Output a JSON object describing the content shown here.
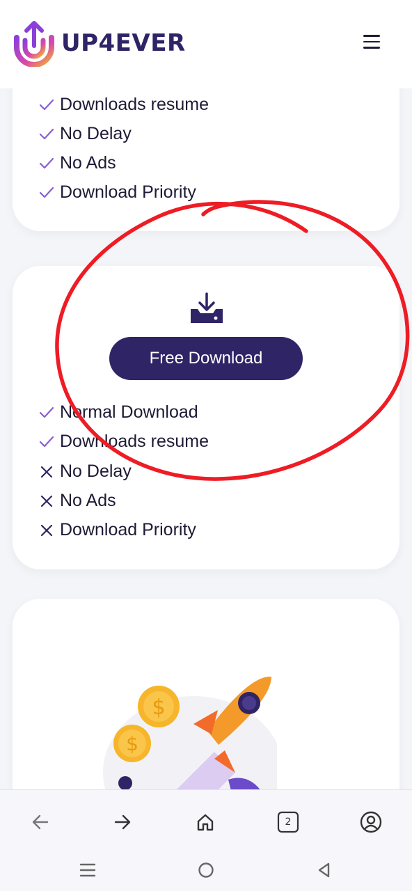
{
  "header": {
    "brand": "UP4EVER",
    "menu_icon": "hamburger-menu-icon"
  },
  "plan_card_top": {
    "features": [
      {
        "label": "Downloads resume",
        "included": true
      },
      {
        "label": "No Delay",
        "included": true
      },
      {
        "label": "No Ads",
        "included": true
      },
      {
        "label": "Download Priority",
        "included": true
      }
    ]
  },
  "free_card": {
    "icon": "download-tray-icon",
    "button_label": "Free Download",
    "features": [
      {
        "label": "Normal Download",
        "included": true
      },
      {
        "label": "Downloads resume",
        "included": true
      },
      {
        "label": "No Delay",
        "included": false
      },
      {
        "label": "No Ads",
        "included": false
      },
      {
        "label": "Download Priority",
        "included": false
      }
    ]
  },
  "browser_nav": {
    "tab_count": "2",
    "buttons": [
      "back-arrow-icon",
      "forward-arrow-icon",
      "home-icon",
      "tabs-icon",
      "account-icon"
    ]
  },
  "system_nav": [
    "recent-apps-icon",
    "home-circle-icon",
    "back-triangle-icon"
  ],
  "colors": {
    "brand": "#2f2466",
    "check": "#8a5cd6",
    "annotation": "#ee1c24"
  }
}
